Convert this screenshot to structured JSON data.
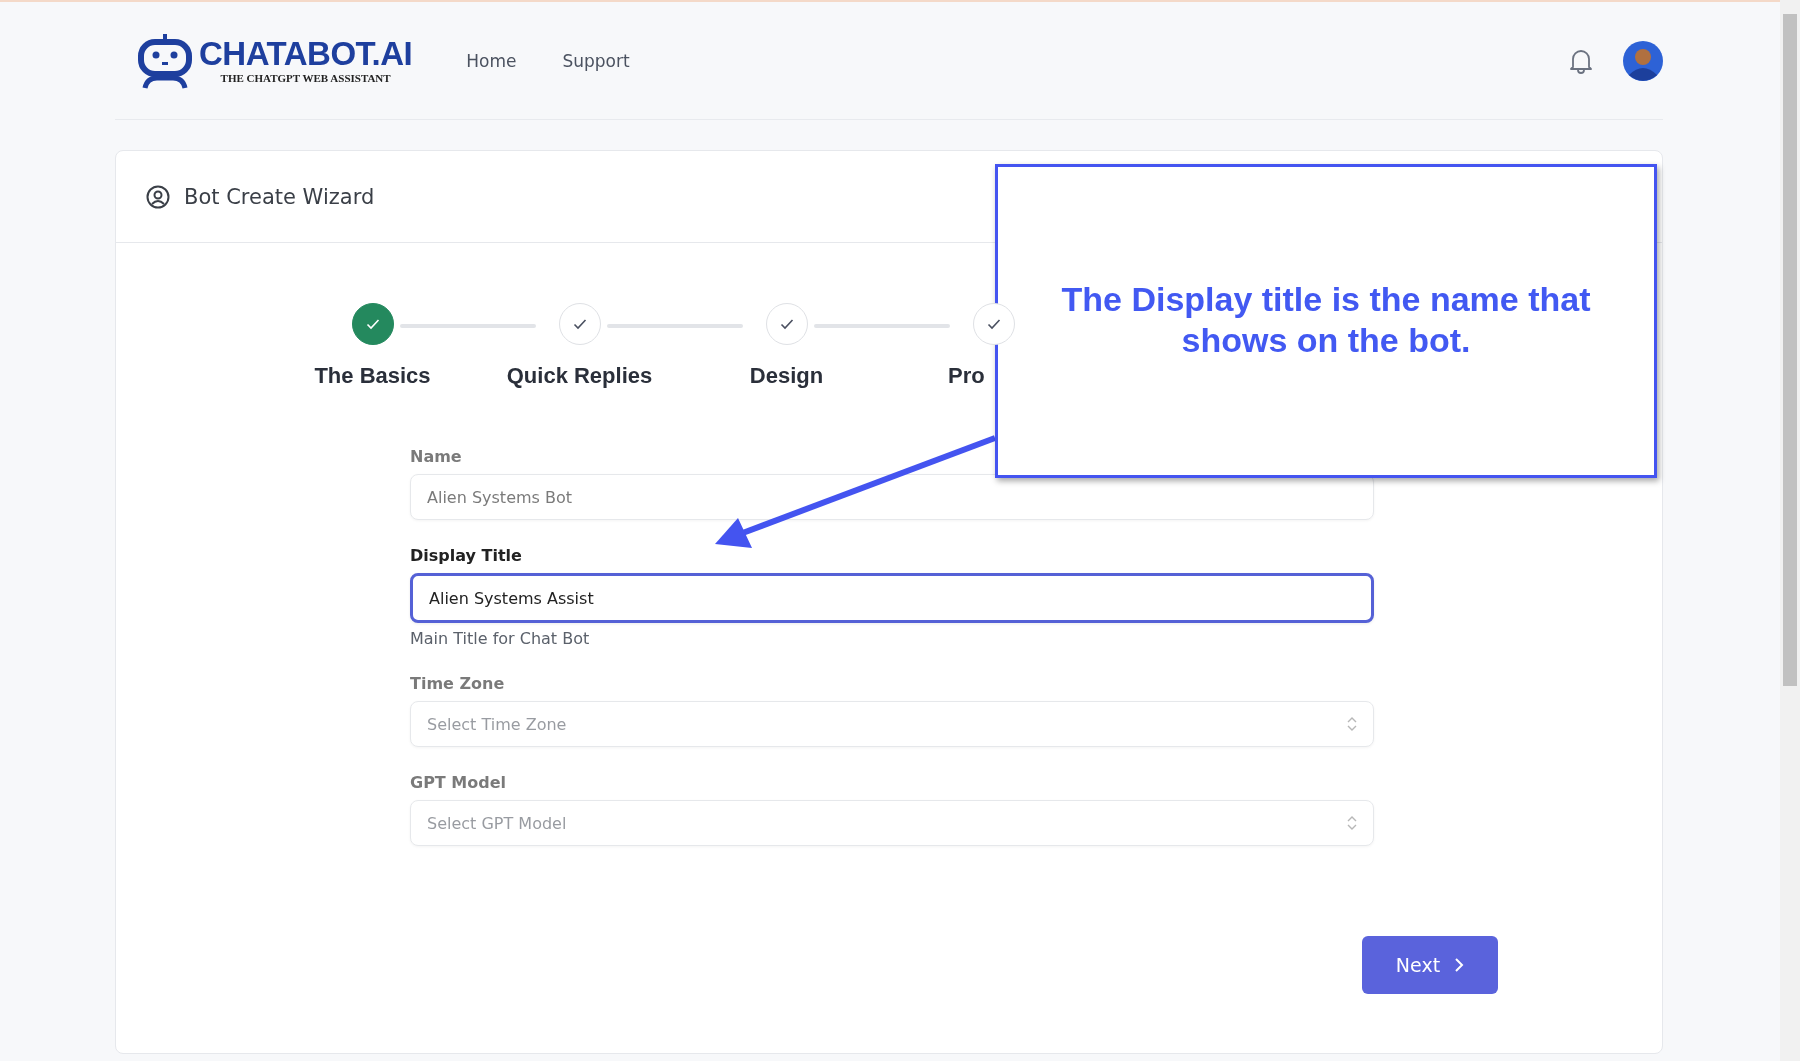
{
  "header": {
    "logo": {
      "name": "CHATABOT.AI",
      "tagline": "THE CHATGPT WEB ASSISTANT"
    },
    "nav": [
      {
        "label": "Home"
      },
      {
        "label": "Support"
      }
    ]
  },
  "card": {
    "title": "Bot Create Wizard",
    "steps": [
      {
        "label": "The Basics",
        "active": true
      },
      {
        "label": "Quick Replies",
        "active": false
      },
      {
        "label": "Design",
        "active": false
      },
      {
        "label": "Pro",
        "active": false
      }
    ],
    "fields": [
      {
        "kind": "input",
        "label": "Name",
        "value": "Alien Systems Bot",
        "highlighted": false
      },
      {
        "kind": "input",
        "label": "Display Title",
        "value": "Alien Systems Assist",
        "help": "Main Title for Chat Bot",
        "highlighted": true
      },
      {
        "kind": "select",
        "label": "Time Zone",
        "placeholder": "Select Time Zone",
        "highlighted": false
      },
      {
        "kind": "select",
        "label": "GPT Model",
        "placeholder": "Select GPT Model",
        "highlighted": false
      }
    ],
    "next_button": "Next"
  },
  "callout": {
    "text": "The Display title is the name that shows on the bot."
  }
}
